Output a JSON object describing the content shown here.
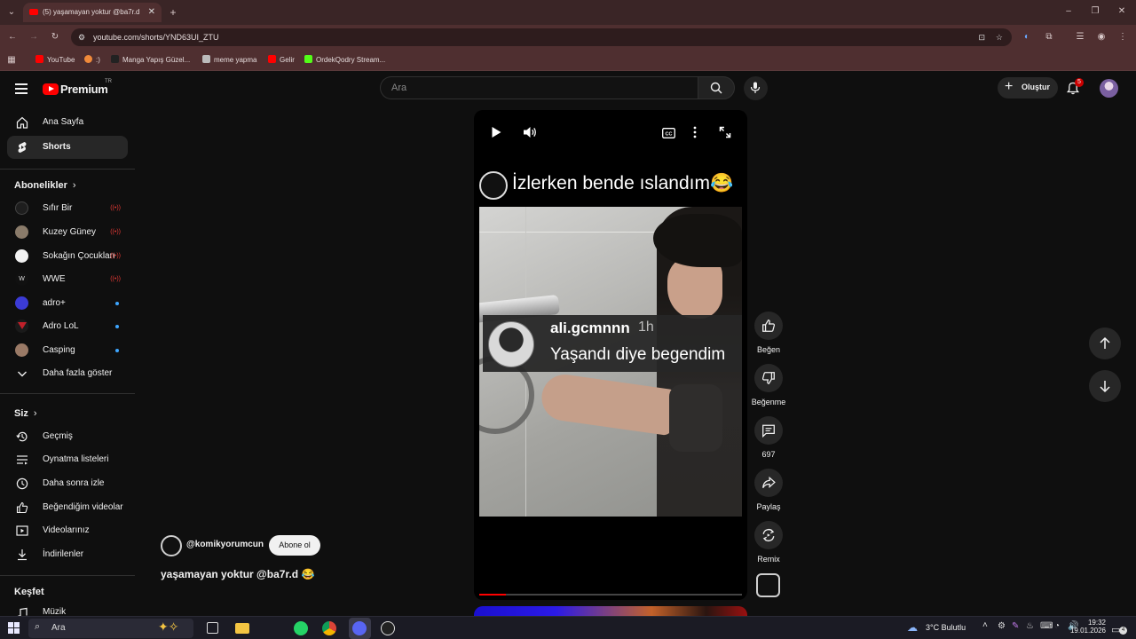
{
  "browser": {
    "tab_title": "(5) yaşamayan yoktur @ba7r.d",
    "url": "youtube.com/shorts/YND63UI_ZTU",
    "bookmarks": [
      "YouTube",
      ":)",
      "Manga Yapış Güzel...",
      "meme yapma",
      "Gelir",
      "OrdekQodry Stream..."
    ]
  },
  "masthead": {
    "logo_text": "Premium",
    "logo_region": "TR",
    "search_placeholder": "Ara",
    "create_label": "Oluştur",
    "notification_count": "5"
  },
  "sidebar": {
    "main": [
      {
        "label": "Ana Sayfa",
        "icon": "home-icon"
      },
      {
        "label": "Shorts",
        "icon": "shorts-icon"
      }
    ],
    "subscriptions_header": "Abonelikler",
    "subscriptions": [
      {
        "label": "Sıfır Bir",
        "status": "live",
        "color": "#222"
      },
      {
        "label": "Kuzey Güney",
        "status": "live",
        "color": "#8a7b6a"
      },
      {
        "label": "Sokağın Çocukları",
        "status": "live",
        "color": "#f2f2f2"
      },
      {
        "label": "WWE",
        "status": "live",
        "color": "#111"
      },
      {
        "label": "adro+",
        "status": "new",
        "color": "#3b3bd6"
      },
      {
        "label": "Adro LoL",
        "status": "new",
        "color": "#1a1a1a"
      },
      {
        "label": "Casping",
        "status": "new",
        "color": "#9a7a66"
      },
      {
        "label": "Daha fazla göster",
        "status": "",
        "color": ""
      }
    ],
    "you_header": "Siz",
    "you": [
      {
        "label": "Geçmiş",
        "icon": "history-icon"
      },
      {
        "label": "Oynatma listeleri",
        "icon": "playlist-icon"
      },
      {
        "label": "Daha sonra izle",
        "icon": "clock-icon"
      },
      {
        "label": "Beğendiğim videolar",
        "icon": "like-icon"
      },
      {
        "label": "Videolarınız",
        "icon": "video-icon"
      },
      {
        "label": "İndirilenler",
        "icon": "download-icon"
      }
    ],
    "explore_header": "Keşfet",
    "explore": [
      {
        "label": "Müzik",
        "icon": "music-icon"
      }
    ]
  },
  "short": {
    "overlay_title": "İzlerken bende ıslandım😂",
    "comment_user": "ali.gcmnnn",
    "comment_time": "1h",
    "comment_text": "Yaşandı diye begendim",
    "channel": "@komikyorumcun",
    "subscribe_label": "Abone ol",
    "caption": "yaşamayan yoktur @ba7r.d 😂",
    "progress": 0.1
  },
  "actions": {
    "like": "Beğen",
    "dislike": "Beğenme",
    "comments": "697",
    "share": "Paylaş",
    "remix": "Remix"
  },
  "taskbar": {
    "search_placeholder": "Ara",
    "weather": "3°C  Bulutlu",
    "time": "19:32",
    "date": "19.01.2026",
    "notification_count": "4"
  }
}
